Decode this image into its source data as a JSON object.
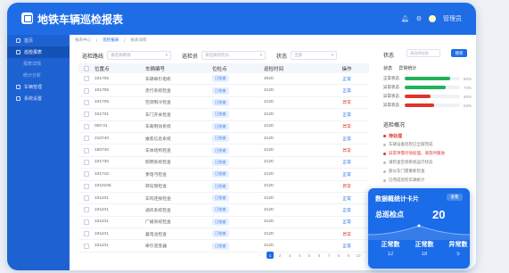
{
  "app": {
    "title": "地铁车辆巡检报表",
    "user": "管理员"
  },
  "sidebar": {
    "items": [
      {
        "label": "首页",
        "active": false,
        "sub": false
      },
      {
        "label": "巡检报表",
        "active": true,
        "sub": false
      },
      {
        "label": "报表详情",
        "active": false,
        "sub": true
      },
      {
        "label": "统计分析",
        "active": false,
        "sub": true
      },
      {
        "label": "车辆管理",
        "active": false,
        "sub": false
      },
      {
        "label": "系统设置",
        "active": false,
        "sub": false
      }
    ]
  },
  "breadcrumb": [
    "报表中心",
    "巡检报表",
    "报表详情"
  ],
  "filters": {
    "route_label": "巡检路线",
    "route_value": "请选择路线",
    "inspector_label": "巡检员",
    "inspector_value": "请选择巡检员",
    "status_label": "状态",
    "status_value": "全部"
  },
  "table": {
    "headers": [
      "",
      "位置点",
      "车辆编号",
      "位检点",
      "巡检时间",
      "巡检人",
      "操作"
    ],
    "rows": [
      {
        "id": "101705",
        "name": "车辆牵引电机",
        "tag": "已检查",
        "time": "2020",
        "status": "正常",
        "ok": true
      },
      {
        "id": "101705",
        "name": "走行系统检查",
        "tag": "已检查",
        "time": "2120",
        "status": "正常",
        "ok": true
      },
      {
        "id": "101705",
        "name": "空调制冷检查",
        "tag": "已检查",
        "time": "2120",
        "status": "异常",
        "ok": false
      },
      {
        "id": "101731",
        "name": "车门开关检查",
        "tag": "已检查",
        "time": "2120",
        "status": "正常",
        "ok": true
      },
      {
        "id": "000 01",
        "name": "车载制动系统",
        "tag": "已检查",
        "time": "2120",
        "status": "异常",
        "ok": false
      },
      {
        "id": "210740",
        "name": "乘客信息系统",
        "tag": "已检查",
        "time": "2120",
        "status": "正常",
        "ok": true
      },
      {
        "id": "150740",
        "name": "车体结构检查",
        "tag": "已检查",
        "time": "2120",
        "status": "异常",
        "ok": false
      },
      {
        "id": "101730",
        "name": "照明系统检查",
        "tag": "已检查",
        "time": "2120",
        "status": "正常",
        "ok": true
      },
      {
        "id": "101710",
        "name": "受电弓检查",
        "tag": "已检查",
        "time": "2120",
        "status": "正常",
        "ok": true
      },
      {
        "id": "1010105",
        "name": "转向架检查",
        "tag": "已检查",
        "time": "2120",
        "status": "异常",
        "ok": false
      },
      {
        "id": "101101",
        "name": "车钩连接检查",
        "tag": "已检查",
        "time": "2120",
        "status": "正常",
        "ok": true
      },
      {
        "id": "101101",
        "name": "通风系统检查",
        "tag": "已检查",
        "time": "2120",
        "status": "正常",
        "ok": true
      },
      {
        "id": "101101",
        "name": "广播系统检查",
        "tag": "已检查",
        "time": "2120",
        "status": "正常",
        "ok": true
      },
      {
        "id": "101101",
        "name": "蓄电池检查",
        "tag": "已检查",
        "time": "2120",
        "status": "异常",
        "ok": false
      },
      {
        "id": "101101",
        "name": "牵引逆变器",
        "tag": "已检查",
        "time": "2120",
        "status": "正常",
        "ok": true
      }
    ]
  },
  "pager": {
    "pages": [
      "1",
      "2",
      "3",
      "4",
      "5",
      "6",
      "7",
      "8",
      "9",
      "10"
    ],
    "current": "1"
  },
  "right": {
    "status_label": "状态",
    "status_input": "请选择状态",
    "query_btn": "搜索",
    "legend_label": "状态",
    "legend_value": "异常统计",
    "bars": [
      {
        "label": "正常状态",
        "pct": 0.82,
        "value": "82%",
        "color": "#1fb35a"
      },
      {
        "label": "异常状态",
        "pct": 0.74,
        "value": "74%",
        "color": "#1fb35a"
      },
      {
        "label": "异常状态",
        "pct": 0.46,
        "value": "46%",
        "color": "#e0342c"
      },
      {
        "label": "异常状态",
        "pct": 0.54,
        "value": "54%",
        "color": "#e0342c"
      }
    ],
    "alerts_title": "巡检概况",
    "alerts": [
      {
        "text": "待处理",
        "color": "#e0342c",
        "strong": true
      },
      {
        "text": "车辆设备巡检已全部完成",
        "color": "#bbb",
        "strong": false
      },
      {
        "text": "异常项需尽快处理，请及时跟进",
        "color": "#e0342c",
        "strong": false
      },
      {
        "text": "请检查空调系统运行状态",
        "color": "#bbb",
        "strong": false
      },
      {
        "text": "部分车门需重新检查",
        "color": "#bbb",
        "strong": false
      },
      {
        "text": "已完成巡检车辆统计",
        "color": "#bbb",
        "strong": false
      }
    ]
  },
  "card": {
    "title": "数据概统计卡片",
    "btn": "查看",
    "total_label": "总巡检点",
    "total_value": "20",
    "stats": [
      {
        "label": "正常数",
        "value": "12"
      },
      {
        "label": "正常数",
        "value": "18"
      },
      {
        "label": "异常数",
        "value": "5"
      }
    ]
  }
}
